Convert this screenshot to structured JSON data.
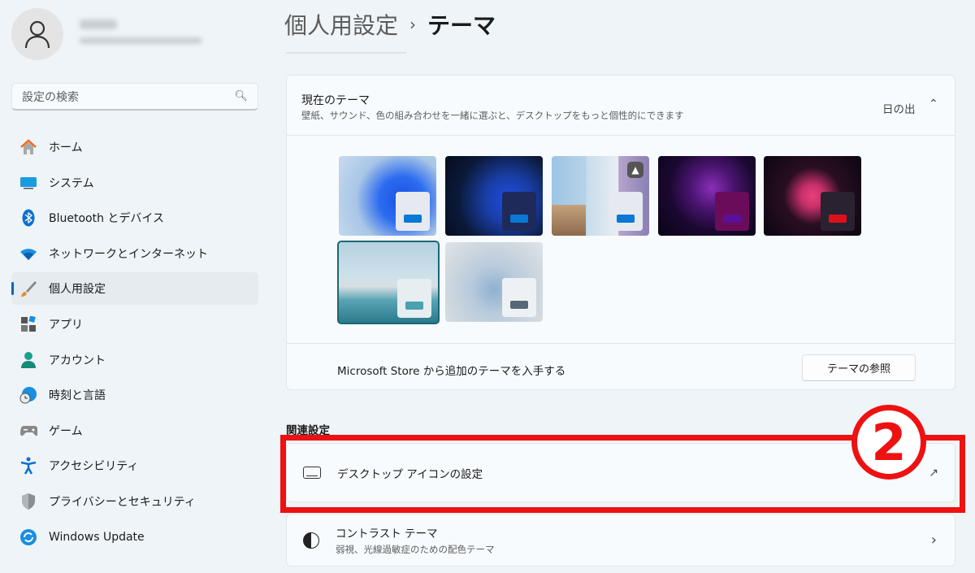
{
  "sidebar": {
    "search_placeholder": "設定の検索",
    "items": [
      {
        "label": "ホーム",
        "icon": "home-icon"
      },
      {
        "label": "システム",
        "icon": "system-icon"
      },
      {
        "label": "Bluetooth とデバイス",
        "icon": "bluetooth-icon"
      },
      {
        "label": "ネットワークとインターネット",
        "icon": "wifi-icon"
      },
      {
        "label": "個人用設定",
        "icon": "brush-icon",
        "active": true
      },
      {
        "label": "アプリ",
        "icon": "apps-icon"
      },
      {
        "label": "アカウント",
        "icon": "account-icon"
      },
      {
        "label": "時刻と言語",
        "icon": "time-language-icon"
      },
      {
        "label": "ゲーム",
        "icon": "gamepad-icon"
      },
      {
        "label": "アクセシビリティ",
        "icon": "accessibility-icon"
      },
      {
        "label": "プライバシーとセキュリティ",
        "icon": "shield-icon"
      },
      {
        "label": "Windows Update",
        "icon": "update-icon"
      }
    ]
  },
  "header": {
    "parent": "個人用設定",
    "separator": "›",
    "current": "テーマ"
  },
  "current_theme": {
    "title": "現在のテーマ",
    "description": "壁紙、サウンド、色の組み合わせを一緒に選ぶと、デスクトップをもっと個性的にできます",
    "value": "日の出"
  },
  "store": {
    "text": "Microsoft Store から追加のテーマを入手する",
    "button": "テーマの参照"
  },
  "related": {
    "heading": "関連設定",
    "desktop_icons": "デスクトップ アイコンの設定",
    "contrast_title": "コントラスト テーマ",
    "contrast_desc": "弱視、光線過敏症のための配色テーマ"
  },
  "annotation": "②",
  "colors": {
    "accent": "#0067c0",
    "annotation_red": "#ee1111"
  }
}
